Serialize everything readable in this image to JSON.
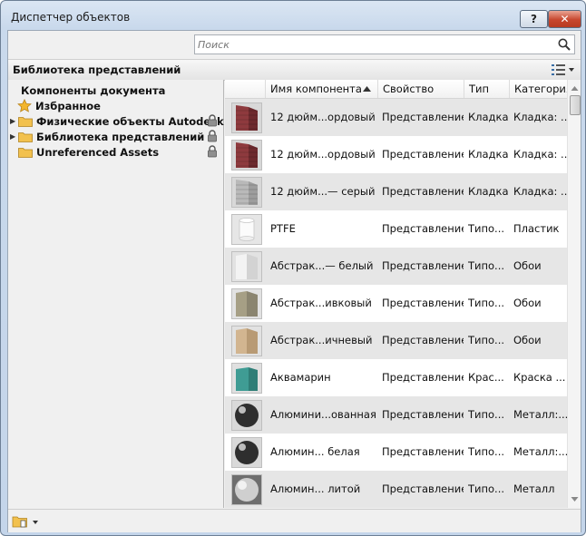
{
  "window": {
    "title": "Диспетчер объектов",
    "help_label": "?",
    "close_label": "✕"
  },
  "search": {
    "placeholder": "Поиск",
    "icon": "search-icon"
  },
  "library_header": {
    "label": "Библиотека представлений",
    "view_icon": "list-view-icon"
  },
  "tree": {
    "document_label": "Компоненты документа",
    "favorites": "Избранное",
    "items": [
      {
        "label": "Физические объекты Autodesk",
        "locked": true
      },
      {
        "label": "Библиотека представлений",
        "locked": true
      },
      {
        "label": "Unreferenced Assets",
        "locked": false
      }
    ]
  },
  "grid": {
    "columns": [
      "Имя компонента",
      "Свойство",
      "Тип",
      "Категория"
    ],
    "sort_column": "Имя компонента",
    "rows": [
      {
        "name": "12 дюйм...ордовый",
        "property": "Представление",
        "type": "Кладка",
        "category": "Кладка: ...",
        "thumb": "brick-red"
      },
      {
        "name": "12 дюйм...ордовый",
        "property": "Представление",
        "type": "Кладка",
        "category": "Кладка: ...",
        "thumb": "brick-red"
      },
      {
        "name": "12 дюйм...— серый",
        "property": "Представление",
        "type": "Кладка",
        "category": "Кладка: ...",
        "thumb": "brick-gray"
      },
      {
        "name": "PTFE",
        "property": "Представление",
        "type": "Типо...",
        "category": "Пластик",
        "thumb": "white-cylinder"
      },
      {
        "name": "Абстрак...— белый",
        "property": "Представление",
        "type": "Типо...",
        "category": "Обои",
        "thumb": "wall-white"
      },
      {
        "name": "Абстрак...ивковый",
        "property": "Представление",
        "type": "Типо...",
        "category": "Обои",
        "thumb": "wall-olive"
      },
      {
        "name": "Абстрак...ичневый",
        "property": "Представление",
        "type": "Типо...",
        "category": "Обои",
        "thumb": "wall-tan"
      },
      {
        "name": "Аквамарин",
        "property": "Представление",
        "type": "Крас...",
        "category": "Краска ...",
        "thumb": "aqua-paint"
      },
      {
        "name": "Алюмини...ованная",
        "property": "Представление",
        "type": "Типо...",
        "category": "Металл:...",
        "thumb": "sphere-dark"
      },
      {
        "name": "Алюмин... белая",
        "property": "Представление",
        "type": "Типо...",
        "category": "Металл:...",
        "thumb": "sphere-dark"
      },
      {
        "name": "Алюмин... литой",
        "property": "Представление",
        "type": "Типо...",
        "category": "Металл",
        "thumb": "sphere-light"
      }
    ]
  },
  "colors": {
    "row_alt": "#e6e6e6",
    "window_frame": "#c4d5ea",
    "close_red": "#c7462e"
  }
}
